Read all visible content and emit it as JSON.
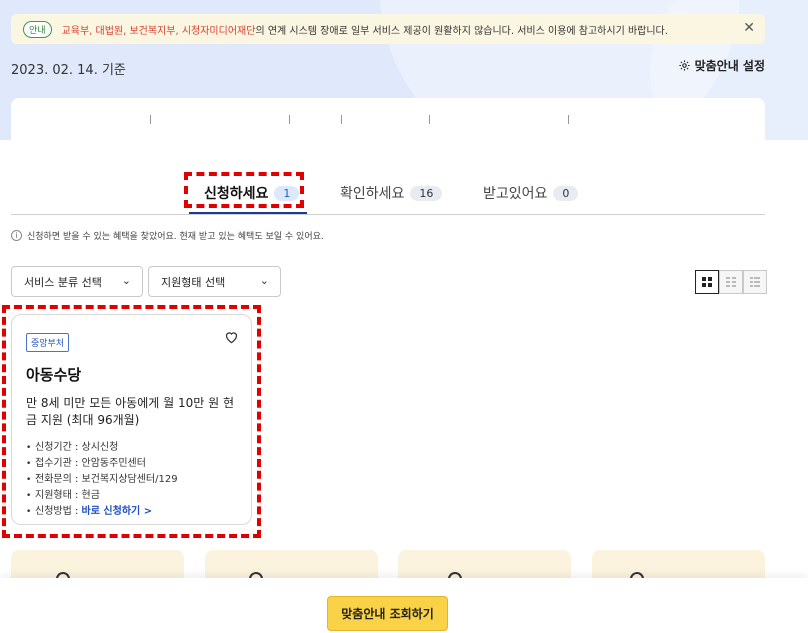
{
  "notice": {
    "badge": "안내",
    "highlight": "교육부, 대법원, 보건복지부, 시청자미디어재단",
    "message": "의 연계 시스템 장애로 일부 서비스 제공이 원활하지 않습니다. 서비스 이용에 참고하시기 바랍니다.",
    "close_icon": "close-icon"
  },
  "header": {
    "base_date": "2023. 02. 14. 기준",
    "settings_label": "맞춤안내 설정",
    "settings_icon": "gear-icon"
  },
  "tabs": [
    {
      "label": "신청하세요",
      "count": "1",
      "active": true
    },
    {
      "label": "확인하세요",
      "count": "16",
      "active": false
    },
    {
      "label": "받고있어요",
      "count": "0",
      "active": false
    }
  ],
  "info_text": "신청하면 받을 수 있는 혜택을 찾았어요. 현재 받고 있는 혜택도 보일 수 있어요.",
  "filters": {
    "service_category": "서비스 분류 선택",
    "support_type": "지원형태 선택"
  },
  "view_modes": [
    "grid-large-icon",
    "grid-medium-icon",
    "list-icon"
  ],
  "card": {
    "badge": "중앙부처",
    "title": "아동수당",
    "description": "만 8세 미만 모든 아동에게 월 10만 원 현금 지원 (최대 96개월)",
    "details": [
      {
        "label": "신청기간 : 상시신청"
      },
      {
        "label": "접수기관 : 안암동주민센터"
      },
      {
        "label": "전화문의 : 보건복지상담센터/129"
      },
      {
        "label": "지원형태 : 현금"
      }
    ],
    "method_label": "신청방법 : ",
    "method_link": "바로 신청하기 >"
  },
  "cta_label": "맞춤안내 조회하기",
  "colors": {
    "hero_bg": "#dfe9fb",
    "accent_yellow": "#f9d247",
    "highlight_red": "#e00000",
    "tab_active": "#1b3c8c"
  }
}
